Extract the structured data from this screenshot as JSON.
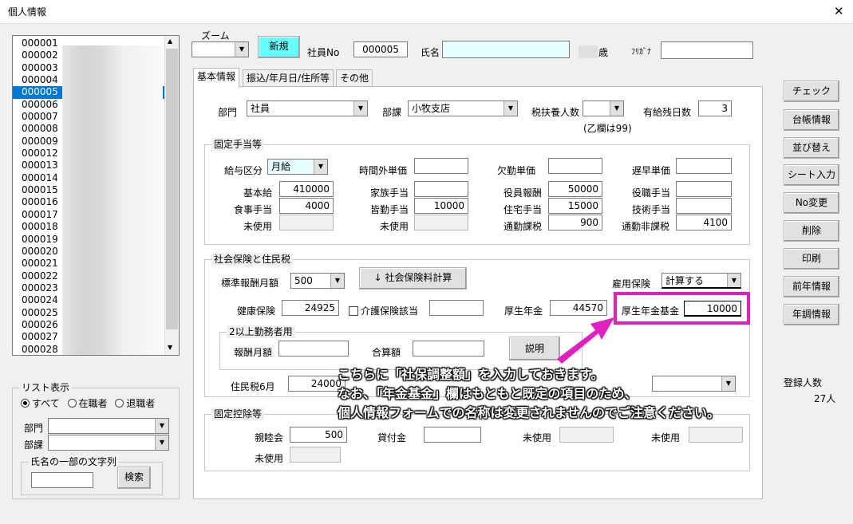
{
  "window": {
    "title": "個人情報",
    "close": "✕"
  },
  "employee_list": {
    "items": [
      "000001",
      "000002",
      "000003",
      "000004",
      "000005",
      "000006",
      "000007",
      "000008",
      "000009",
      "000012",
      "000013",
      "000014",
      "000015",
      "000016",
      "000017",
      "000018",
      "000019",
      "000020",
      "000021",
      "000022",
      "000023",
      "000024",
      "000025",
      "000026",
      "000027",
      "000028"
    ],
    "selected": "000005"
  },
  "scroll": {
    "up": "▲",
    "down": "▼"
  },
  "list_filter": {
    "title": "リスト表示",
    "options": [
      "すべて",
      "在職者",
      "退職者"
    ],
    "selected": "すべて",
    "dept_label": "部門",
    "section_label": "部課",
    "name_search_title": "氏名の一部の文字列",
    "search_button": "検索"
  },
  "header": {
    "zoom_label": "ズーム",
    "new_button": "新規",
    "emp_no_label": "社員No",
    "emp_no": "000005",
    "name_label": "氏名",
    "age_suffix": "歳",
    "kana_label": "ﾌﾘｶﾞﾅ"
  },
  "tabs": [
    "基本情報",
    "振込/年月日/住所等",
    "その他"
  ],
  "basic": {
    "dept_label": "部門",
    "dept": "社員",
    "section_label": "部課",
    "section": "小牧支店",
    "dependents_label": "税扶養人数",
    "dependents_note": "(乙欄は99)",
    "leave_label": "有給残日数",
    "leave": "3"
  },
  "allowances": {
    "title": "固定手当等",
    "pay_type_label": "給与区分",
    "pay_type": "月給",
    "overtime_label": "時間外単価",
    "overtime": "",
    "absence_label": "欠勤単価",
    "absence": "",
    "late_label": "遅早単価",
    "late": "",
    "base_label": "基本給",
    "base": "410000",
    "family_label": "家族手当",
    "family": "",
    "officer_label": "役員報酬",
    "officer": "50000",
    "position_label": "役職手当",
    "position": "",
    "meal_label": "食事手当",
    "meal": "4000",
    "attendance_label": "皆勤手当",
    "attendance": "10000",
    "housing_label": "住宅手当",
    "housing": "15000",
    "skill_label": "技術手当",
    "skill": "",
    "unused_label": "未使用",
    "unused": "",
    "unused2_label": "未使用",
    "unused2": "",
    "commute_tax_label": "通勤課税",
    "commute_tax": "900",
    "commute_free_label": "通勤非課税",
    "commute_free": "4100"
  },
  "insurance": {
    "title": "社会保険と住民税",
    "std_label": "標準報酬月額",
    "std": "500",
    "calc_button": "↓ 社会保険料計算",
    "employment_label": "雇用保険",
    "employment": "計算する",
    "health_label": "健康保険",
    "health": "24925",
    "care_label": "介護保険該当",
    "care": "",
    "pension_label": "厚生年金",
    "pension": "44570",
    "fund_label": "厚生年金基金",
    "fund": "10000",
    "multi_title": "2以上勤務者用",
    "remun_label": "報酬月額",
    "remun": "",
    "total_label": "合算額",
    "total": "",
    "explain_button": "説明",
    "resident_label": "住民税6月",
    "resident": "24000"
  },
  "deductions": {
    "title": "固定控除等",
    "social_label": "親睦会",
    "social": "500",
    "loan_label": "貸付金",
    "loan": "",
    "unused1_label": "未使用",
    "unused1": "",
    "unused2_label": "未使用",
    "unused2": "",
    "unused3_label": "未使用",
    "unused3": ""
  },
  "side_buttons": [
    "チェック",
    "台帳情報",
    "並び替え",
    "シート入力",
    "No変更",
    "削除",
    "印刷",
    "前年情報",
    "年調情報"
  ],
  "registration": {
    "label": "登録人数",
    "count": "27人"
  },
  "annotation": {
    "line1": "こちらに「社保調整額」を入力しておきます。",
    "line2": "なお、「年金基金」欄はもともと既定の項目のため、",
    "line3": "個人情報フォームでの名称は変更されませんのでご注意ください。"
  },
  "colors": {
    "highlight": "#e020c0",
    "selection": "#0078d7",
    "new_button": "#66ffff"
  }
}
